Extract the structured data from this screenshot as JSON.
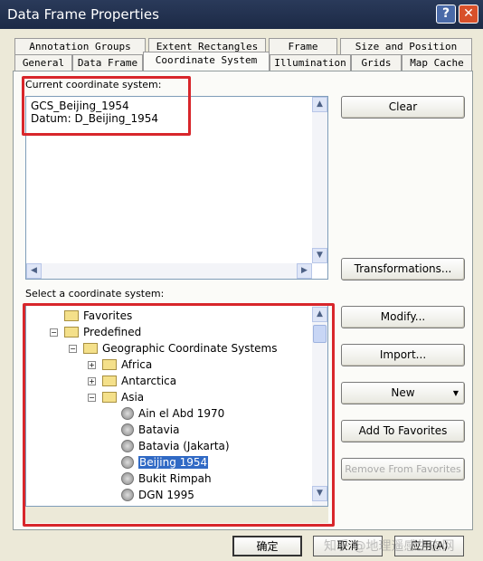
{
  "window": {
    "title": "Data Frame Properties",
    "help": "?",
    "close": "✕"
  },
  "tabs_row1": [
    "Annotation Groups",
    "Extent Rectangles",
    "Frame",
    "Size and Position"
  ],
  "tabs_row2": [
    "General",
    "Data Frame",
    "Coordinate System",
    "Illumination",
    "Grids",
    "Map Cache"
  ],
  "active_tab": "Coordinate System",
  "current": {
    "label": "Current coordinate system:",
    "lines": [
      "GCS_Beijing_1954",
      "Datum: D_Beijing_1954"
    ]
  },
  "buttons": {
    "clear": "Clear",
    "transformations": "Transformations...",
    "modify": "Modify...",
    "import": "Import...",
    "new": "New",
    "add_fav": "Add To Favorites",
    "remove_fav": "Remove From Favorites"
  },
  "select": {
    "label": "Select a coordinate system:"
  },
  "tree": [
    {
      "label": "Favorites",
      "icon": "folder",
      "level": 1
    },
    {
      "label": "Predefined",
      "icon": "folder-open",
      "level": 1,
      "expanded": true
    },
    {
      "label": "Geographic Coordinate Systems",
      "icon": "folder-open",
      "level": 2,
      "expanded": true
    },
    {
      "label": "Africa",
      "icon": "folder",
      "level": 3,
      "expanded": false
    },
    {
      "label": "Antarctica",
      "icon": "folder",
      "level": 3,
      "expanded": false
    },
    {
      "label": "Asia",
      "icon": "folder-open",
      "level": 3,
      "expanded": true
    },
    {
      "label": "Ain el Abd 1970",
      "icon": "globe",
      "level": 4
    },
    {
      "label": "Batavia",
      "icon": "globe",
      "level": 4
    },
    {
      "label": "Batavia (Jakarta)",
      "icon": "globe",
      "level": 4
    },
    {
      "label": "Beijing 1954",
      "icon": "globe",
      "level": 4,
      "selected": true
    },
    {
      "label": "Bukit Rimpah",
      "icon": "globe",
      "level": 4
    },
    {
      "label": "DGN 1995",
      "icon": "globe",
      "level": 4
    }
  ],
  "footer": {
    "ok": "确定",
    "cancel": "取消",
    "apply": "应用(A)"
  },
  "watermark": "知乎 @地理遥感生态网",
  "colors": {
    "highlight": "#d8262b",
    "selection": "#316ac5"
  }
}
